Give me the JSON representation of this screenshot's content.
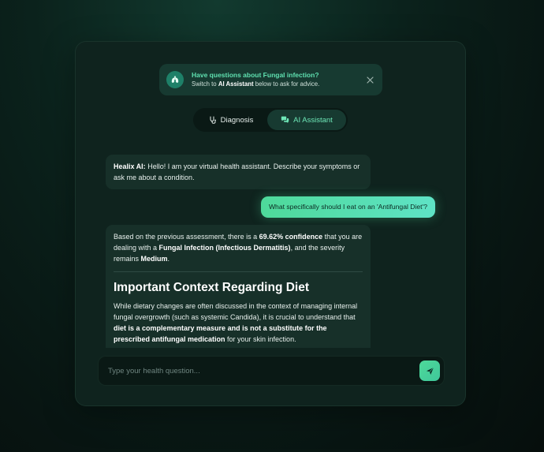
{
  "banner": {
    "title": "Have questions about Fungal infection?",
    "sub_prefix": "Switch to ",
    "sub_bold": "AI Assistant",
    "sub_suffix": " below to ask for advice."
  },
  "tabs": [
    {
      "label": "Diagnosis",
      "icon": "stethoscope-icon",
      "active": false
    },
    {
      "label": "AI Assistant",
      "icon": "chat-bubbles-icon",
      "active": true
    }
  ],
  "messages": {
    "greeting": {
      "sender": "Healix AI:",
      "text": " Hello! I am your virtual health assistant. Describe your symptoms or ask me about a condition."
    },
    "user": {
      "text": "What specifically should I eat on an 'Antifungal Diet'?"
    },
    "reply": {
      "p1_a": "Based on the previous assessment, there is a ",
      "p1_confidence": "69.62% confidence",
      "p1_b": " that you are dealing with a ",
      "p1_condition": "Fungal Infection (Infectious Dermatitis)",
      "p1_c": ", and the severity remains ",
      "p1_severity": "Medium",
      "p1_d": ".",
      "heading": "Important Context Regarding Diet",
      "p2_a": "While dietary changes are often discussed in the context of managing internal fungal overgrowth (such as systemic Candida), it is crucial to understand that ",
      "p2_bold": "diet is a complementary measure and is not a substitute for the prescribed antifungal medication",
      "p2_b": " for your skin infection."
    }
  },
  "input": {
    "placeholder": "Type your health question..."
  },
  "colors": {
    "accent": "#4ed99a",
    "banner_title": "#5fe0b0",
    "card": "#0f231e"
  }
}
